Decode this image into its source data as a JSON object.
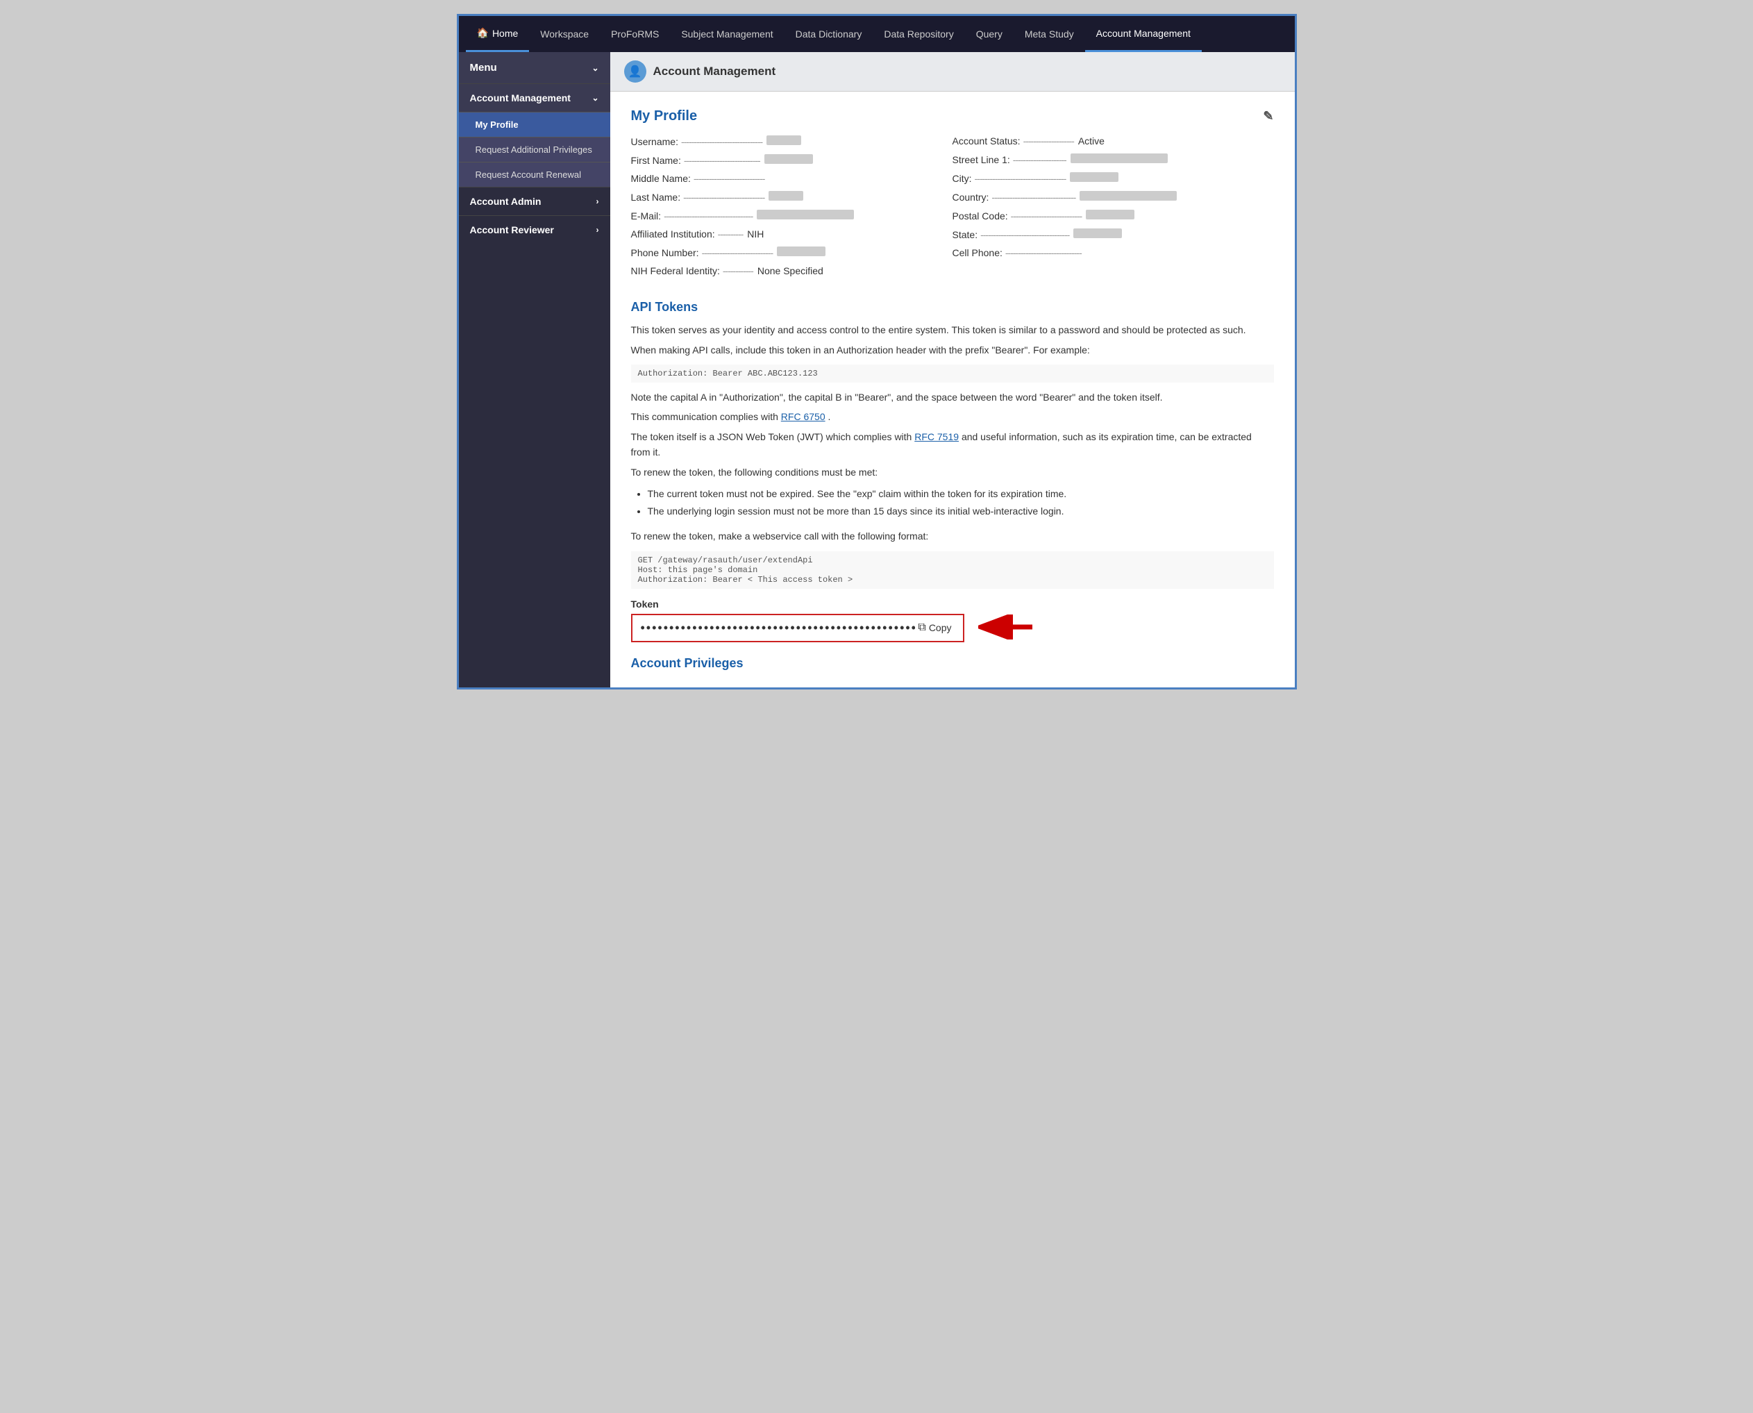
{
  "topnav": {
    "items": [
      {
        "label": "Home",
        "icon": "🏠",
        "active": false,
        "isHome": true
      },
      {
        "label": "Workspace",
        "active": false
      },
      {
        "label": "ProFoRMS",
        "active": false
      },
      {
        "label": "Subject Management",
        "active": false
      },
      {
        "label": "Data Dictionary",
        "active": false
      },
      {
        "label": "Data Repository",
        "active": false
      },
      {
        "label": "Query",
        "active": false
      },
      {
        "label": "Meta Study",
        "active": false
      },
      {
        "label": "Account Management",
        "active": true
      }
    ]
  },
  "sidebar": {
    "menu_label": "Menu",
    "sections": [
      {
        "label": "Account Management",
        "expanded": true,
        "items": [
          {
            "label": "My Profile",
            "active": true
          },
          {
            "label": "Request Additional Privileges",
            "active": false
          },
          {
            "label": "Request Account Renewal",
            "active": false
          }
        ]
      },
      {
        "label": "Account Admin",
        "expanded": false,
        "items": []
      },
      {
        "label": "Account Reviewer",
        "expanded": false,
        "items": []
      }
    ]
  },
  "page_header": {
    "icon": "👤",
    "title": "Account Management"
  },
  "my_profile": {
    "section_title": "My Profile",
    "fields_left": [
      {
        "label": "Username:",
        "dots": "--------------------------------",
        "value_type": "blur",
        "value_width": "short"
      },
      {
        "label": "First Name:",
        "dots": "------------------------------",
        "value_type": "blur",
        "value_width": "medium"
      },
      {
        "label": "Middle Name:",
        "dots": "----------------------------",
        "value_type": "empty"
      },
      {
        "label": "Last Name:",
        "dots": "--------------------------------",
        "value_type": "blur",
        "value_width": "short"
      },
      {
        "label": "E-Mail:",
        "dots": "-----------------------------------",
        "value_type": "blur",
        "value_width": "wide"
      },
      {
        "label": "Affiliated Institution:",
        "dots": "----------",
        "value_type": "text",
        "value": "NIH"
      },
      {
        "label": "Phone Number:",
        "dots": "----------------------------",
        "value_type": "blur",
        "value_width": "medium"
      },
      {
        "label": "NIH Federal Identity:",
        "dots": "------------",
        "value_type": "text",
        "value": "None Specified"
      }
    ],
    "fields_right": [
      {
        "label": "Account Status:",
        "dots": "--------------------",
        "value_type": "text",
        "value": "Active"
      },
      {
        "label": "Street Line 1:",
        "dots": "---------------------",
        "value_type": "blur",
        "value_width": "wide"
      },
      {
        "label": "City:",
        "dots": "------------------------------------",
        "value_type": "blur",
        "value_width": "medium"
      },
      {
        "label": "Country:",
        "dots": "---------------------------------",
        "value_type": "blur",
        "value_width": "wide"
      },
      {
        "label": "Postal Code:",
        "dots": "----------------------------",
        "value_type": "blur",
        "value_width": "medium"
      },
      {
        "label": "State:",
        "dots": "-----------------------------------",
        "value_type": "blur",
        "value_width": "medium"
      },
      {
        "label": "Cell Phone:",
        "dots": "------------------------------",
        "value_type": "empty"
      }
    ]
  },
  "api_tokens": {
    "section_title": "API Tokens",
    "desc1": "This token serves as your identity and access control to the entire system. This token is similar to a password and should be protected as such.",
    "desc2": "When making API calls, include this token in an Authorization header with the prefix \"Bearer\". For example:",
    "code_example": "Authorization: Bearer ABC.ABC123.123",
    "note1": "Note the capital A in \"Authorization\", the capital B in \"Bearer\", and the space between the word \"Bearer\" and the token itself.",
    "note2_prefix": "This communication complies with ",
    "rfc6750_label": "RFC 6750",
    "note2_suffix": ".",
    "note3_prefix": "The token itself is a JSON Web Token (JWT) which complies with ",
    "rfc7519_label": "RFC 7519",
    "note3_suffix": " and useful information, such as its expiration time, can be extracted from it.",
    "note4": "To renew the token, the following conditions must be met:",
    "bullets": [
      "The current token must not be expired. See the \"exp\" claim within the token for its expiration time.",
      "The underlying login session must not be more than 15 days since its initial web-interactive login."
    ],
    "renew_intro": "To renew the token, make a webservice call with the following format:",
    "renew_code": "GET /gateway/rasauth/user/extendApi\nHost: this page's domain\nAuthorization: Bearer < This access token >",
    "token_label": "Token",
    "token_value": "••••••••••••••••••••••••••••••••••••••••••••••••••",
    "copy_label": "Copy"
  },
  "account_privileges": {
    "section_title": "Account Privileges"
  }
}
